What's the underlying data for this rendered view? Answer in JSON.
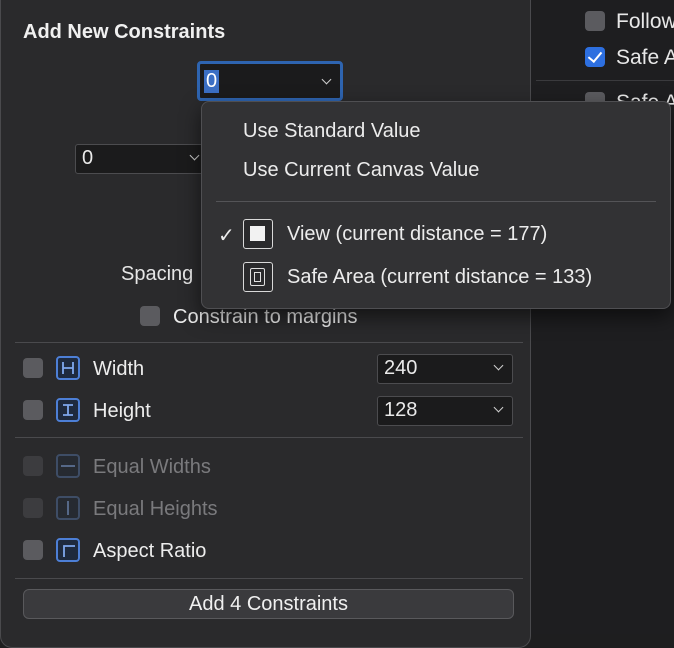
{
  "background": {
    "items": [
      {
        "label": "Follow",
        "checked": false
      },
      {
        "label": "Safe A",
        "checked": true
      },
      {
        "label": "Safe A",
        "checked": false
      }
    ]
  },
  "popover": {
    "title": "Add New Constraints",
    "top_value": "0",
    "left_value": "0",
    "spacing_label": "Spacing",
    "constrain_margins": "Constrain to margins",
    "width": {
      "label": "Width",
      "value": "240"
    },
    "height": {
      "label": "Height",
      "value": "128"
    },
    "equal_widths": "Equal Widths",
    "equal_heights": "Equal Heights",
    "aspect_ratio": "Aspect Ratio",
    "add_button": "Add 4 Constraints"
  },
  "menu": {
    "use_standard": "Use Standard Value",
    "use_canvas": "Use Current Canvas Value",
    "view_option": "View (current distance = 177)",
    "safe_area_option": "Safe Area (current distance = 133)",
    "checkmark": "✓"
  },
  "colors": {
    "accent": "#2d6fe0",
    "popover_bg": "#2a2a2c",
    "menu_bg": "#323234"
  }
}
